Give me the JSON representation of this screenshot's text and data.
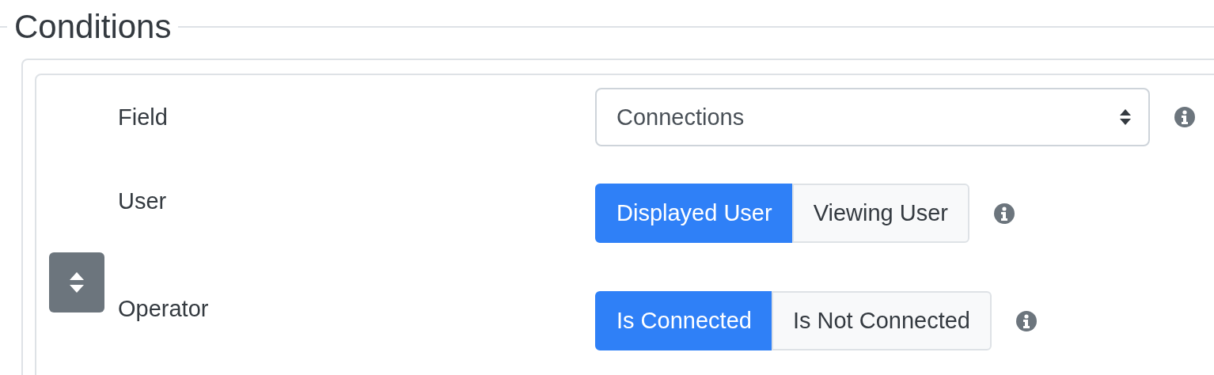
{
  "legend": "Conditions",
  "rows": [
    {
      "kind": "select",
      "label": "Field",
      "value": "Connections"
    },
    {
      "kind": "toggle",
      "label": "User",
      "options": [
        {
          "label": "Displayed User",
          "selected": true
        },
        {
          "label": "Viewing User",
          "selected": false
        }
      ]
    },
    {
      "kind": "toggle",
      "label": "Operator",
      "options": [
        {
          "label": "Is Connected",
          "selected": true
        },
        {
          "label": "Is Not Connected",
          "selected": false
        }
      ]
    }
  ]
}
